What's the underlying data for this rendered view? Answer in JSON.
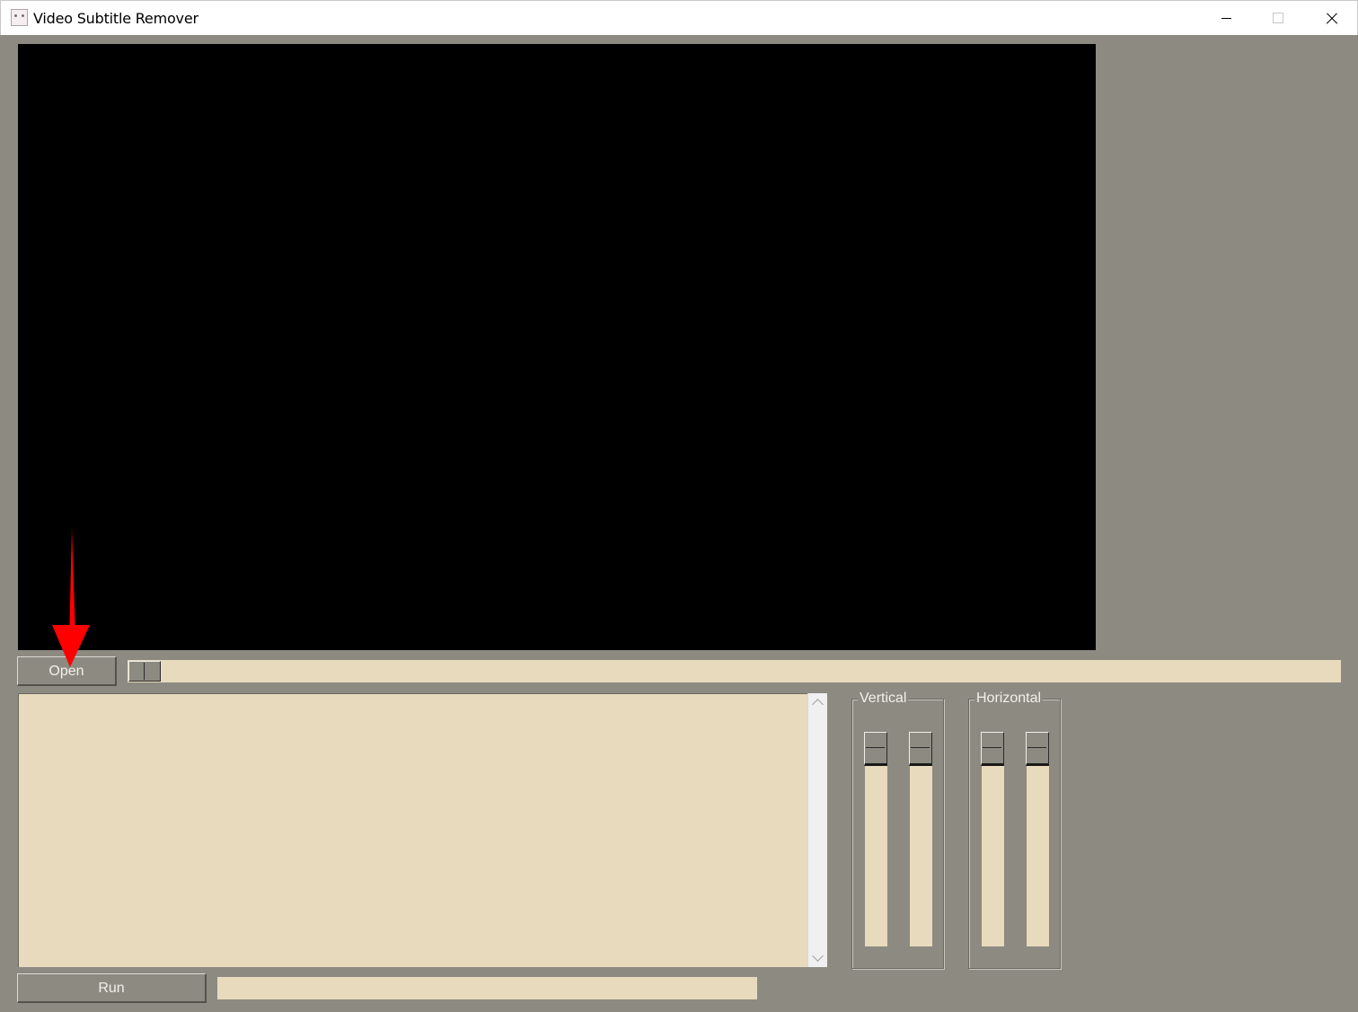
{
  "window": {
    "title": "Video Subtitle Remover",
    "icon": "app-icon",
    "controls": [
      "minimize-icon",
      "maximize-icon",
      "close-icon"
    ]
  },
  "toolbar": {
    "open_label": "Open"
  },
  "actions": {
    "run_label": "Run"
  },
  "log": {
    "text": ""
  },
  "groups": {
    "vertical_label": "Vertical",
    "horizontal_label": "Horizontal"
  },
  "colors": {
    "background": "#8c8a81",
    "field": "#e8dabd",
    "video": "#000000",
    "annotation": "#ff0000"
  },
  "annotation": {
    "type": "arrow",
    "points_to": "open-button",
    "color": "#ff0000"
  }
}
